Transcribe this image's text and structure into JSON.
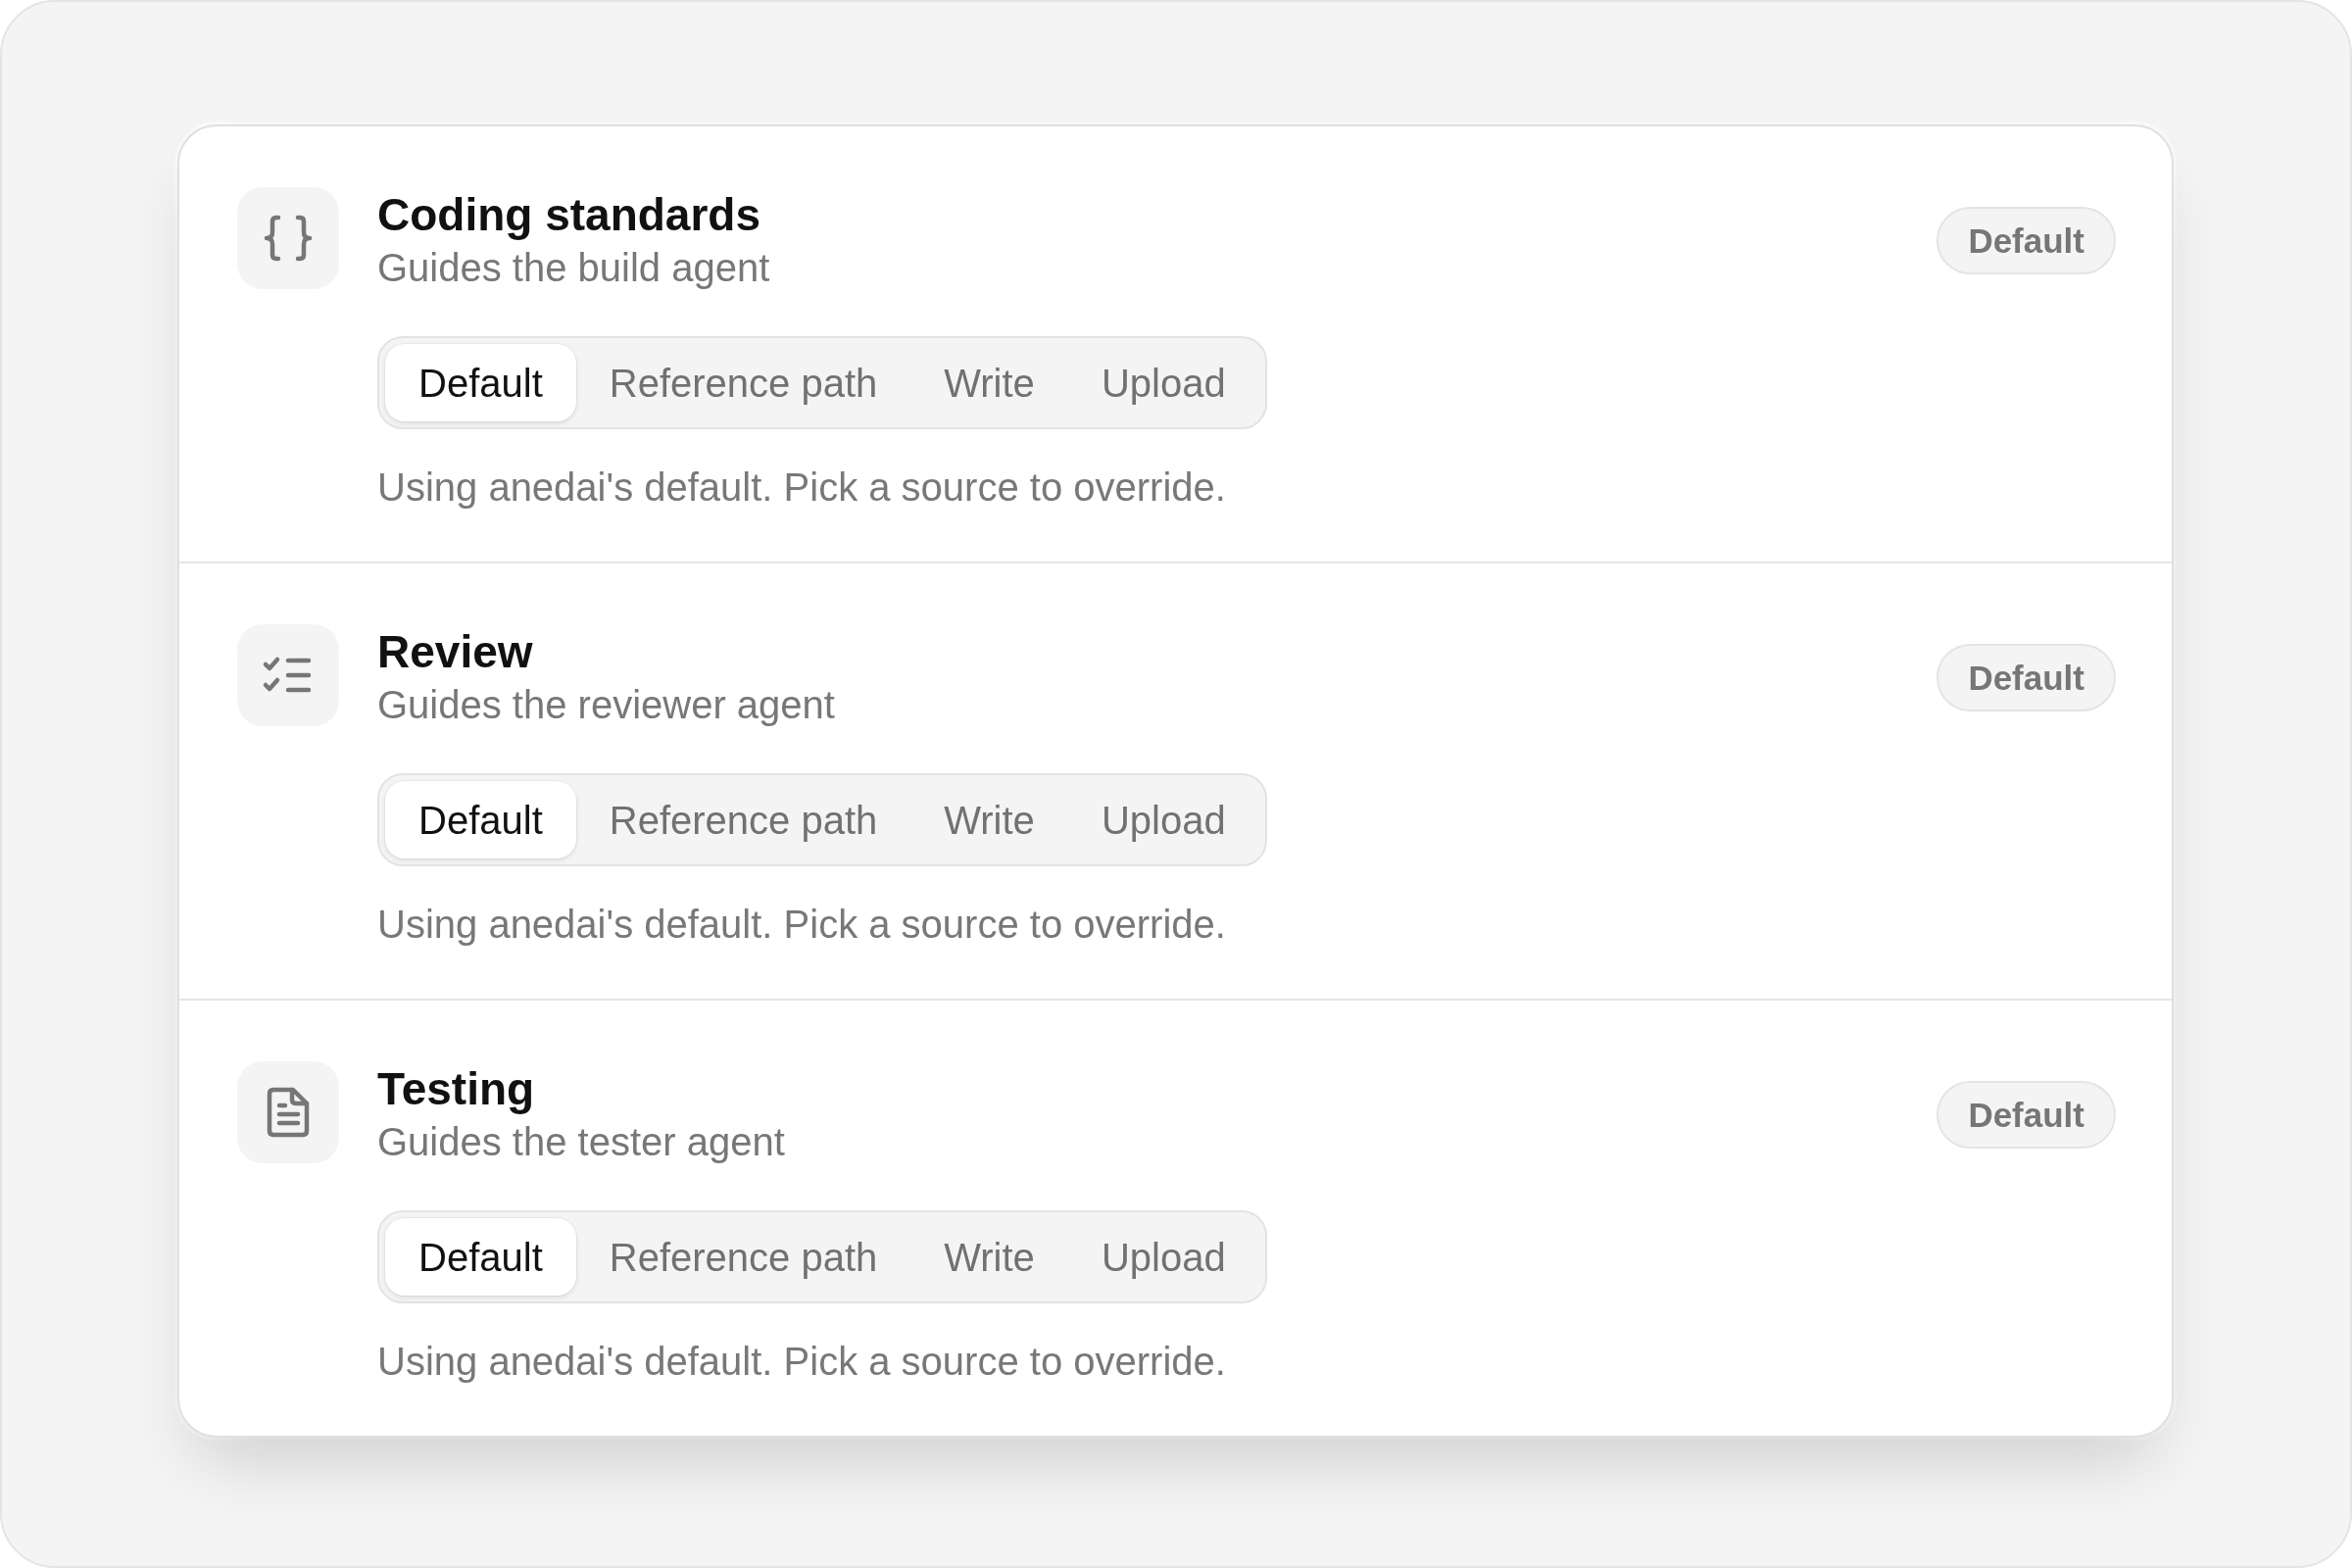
{
  "sections": [
    {
      "kind": "code",
      "title": "Coding standards",
      "subtitle": "Guides the build agent",
      "badge": "Default",
      "options": [
        {
          "label": "Default",
          "selected": true
        },
        {
          "label": "Reference path",
          "selected": false
        },
        {
          "label": "Write",
          "selected": false
        },
        {
          "label": "Upload",
          "selected": false
        }
      ],
      "hint": "Using anedai's default. Pick a source to override."
    },
    {
      "kind": "checklist",
      "title": "Review",
      "subtitle": "Guides the reviewer agent",
      "badge": "Default",
      "options": [
        {
          "label": "Default",
          "selected": true
        },
        {
          "label": "Reference path",
          "selected": false
        },
        {
          "label": "Write",
          "selected": false
        },
        {
          "label": "Upload",
          "selected": false
        }
      ],
      "hint": "Using anedai's default. Pick a source to override."
    },
    {
      "kind": "document",
      "title": "Testing",
      "subtitle": "Guides the tester agent",
      "badge": "Default",
      "options": [
        {
          "label": "Default",
          "selected": true
        },
        {
          "label": "Reference path",
          "selected": false
        },
        {
          "label": "Write",
          "selected": false
        },
        {
          "label": "Upload",
          "selected": false
        }
      ],
      "hint": "Using anedai's default. Pick a source to override."
    }
  ]
}
